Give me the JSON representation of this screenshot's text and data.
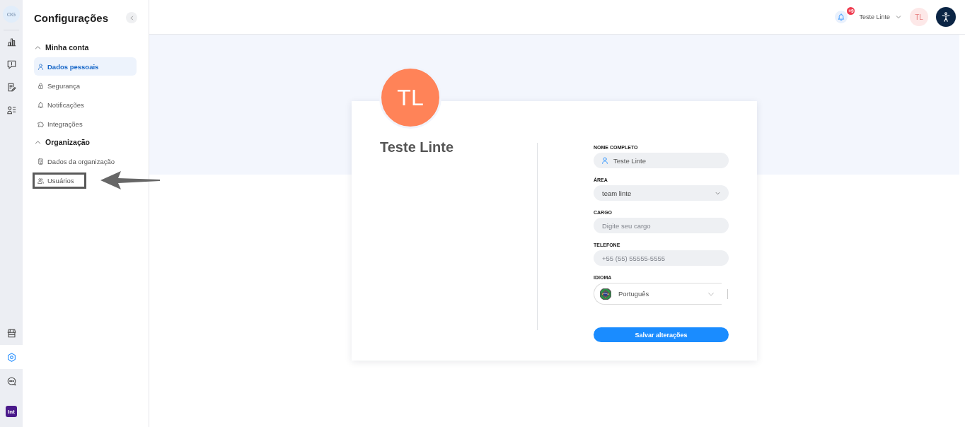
{
  "rail": {
    "badge": "OG",
    "top_items": [
      {
        "selected": false
      },
      {
        "selected": false
      },
      {
        "selected": false
      },
      {
        "selected": false
      }
    ],
    "bottom_items": [
      {
        "selected": false
      },
      {
        "selected": true
      },
      {
        "selected": false
      }
    ],
    "logo": "lnt"
  },
  "sidebar": {
    "title": "Configurações",
    "sections": [
      {
        "label": "Minha conta",
        "expanded": true,
        "items": [
          {
            "label": "Dados pessoais",
            "selected": true,
            "highlighted": false
          },
          {
            "label": "Segurança",
            "selected": false,
            "highlighted": false
          },
          {
            "label": "Notificações",
            "selected": false,
            "highlighted": false
          },
          {
            "label": "Integrações",
            "selected": false,
            "highlighted": false
          }
        ]
      },
      {
        "label": "Organização",
        "expanded": true,
        "items": [
          {
            "label": "Dados da organização",
            "selected": false,
            "highlighted": false
          },
          {
            "label": "Usuários",
            "selected": false,
            "highlighted": true
          }
        ]
      }
    ]
  },
  "header": {
    "notification_badge": "+9",
    "user_name": "Teste Linte",
    "user_initials": "TL"
  },
  "profile": {
    "initials": "TL",
    "name": "Teste Linte",
    "fields": [
      {
        "kind": "person",
        "label": "NOME COMPLETO",
        "value": "Teste Linte"
      },
      {
        "kind": "select",
        "label": "ÁREA",
        "value": "team linte"
      },
      {
        "kind": "text",
        "label": "CARGO",
        "placeholder": "Digite seu cargo"
      },
      {
        "kind": "text",
        "label": "TELEFONE",
        "placeholder": "+55 (55) 55555-5555"
      },
      {
        "kind": "language",
        "label": "IDIOMA",
        "value": "Português"
      }
    ],
    "submit": "Salvar alterações"
  }
}
